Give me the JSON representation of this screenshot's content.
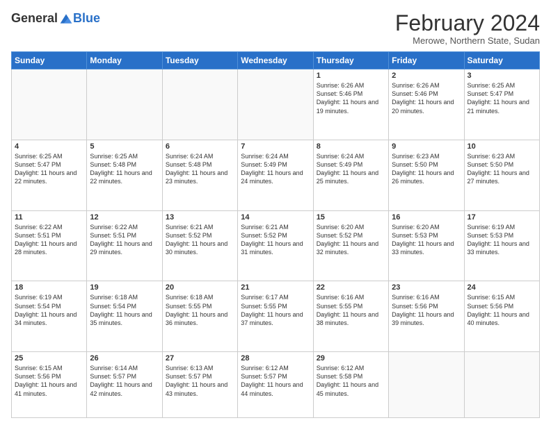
{
  "logo": {
    "general": "General",
    "blue": "Blue"
  },
  "header": {
    "month": "February 2024",
    "location": "Merowe, Northern State, Sudan"
  },
  "days_of_week": [
    "Sunday",
    "Monday",
    "Tuesday",
    "Wednesday",
    "Thursday",
    "Friday",
    "Saturday"
  ],
  "weeks": [
    [
      {
        "day": "",
        "info": ""
      },
      {
        "day": "",
        "info": ""
      },
      {
        "day": "",
        "info": ""
      },
      {
        "day": "",
        "info": ""
      },
      {
        "day": "1",
        "info": "Sunrise: 6:26 AM\nSunset: 5:46 PM\nDaylight: 11 hours and 19 minutes."
      },
      {
        "day": "2",
        "info": "Sunrise: 6:26 AM\nSunset: 5:46 PM\nDaylight: 11 hours and 20 minutes."
      },
      {
        "day": "3",
        "info": "Sunrise: 6:25 AM\nSunset: 5:47 PM\nDaylight: 11 hours and 21 minutes."
      }
    ],
    [
      {
        "day": "4",
        "info": "Sunrise: 6:25 AM\nSunset: 5:47 PM\nDaylight: 11 hours and 22 minutes."
      },
      {
        "day": "5",
        "info": "Sunrise: 6:25 AM\nSunset: 5:48 PM\nDaylight: 11 hours and 22 minutes."
      },
      {
        "day": "6",
        "info": "Sunrise: 6:24 AM\nSunset: 5:48 PM\nDaylight: 11 hours and 23 minutes."
      },
      {
        "day": "7",
        "info": "Sunrise: 6:24 AM\nSunset: 5:49 PM\nDaylight: 11 hours and 24 minutes."
      },
      {
        "day": "8",
        "info": "Sunrise: 6:24 AM\nSunset: 5:49 PM\nDaylight: 11 hours and 25 minutes."
      },
      {
        "day": "9",
        "info": "Sunrise: 6:23 AM\nSunset: 5:50 PM\nDaylight: 11 hours and 26 minutes."
      },
      {
        "day": "10",
        "info": "Sunrise: 6:23 AM\nSunset: 5:50 PM\nDaylight: 11 hours and 27 minutes."
      }
    ],
    [
      {
        "day": "11",
        "info": "Sunrise: 6:22 AM\nSunset: 5:51 PM\nDaylight: 11 hours and 28 minutes."
      },
      {
        "day": "12",
        "info": "Sunrise: 6:22 AM\nSunset: 5:51 PM\nDaylight: 11 hours and 29 minutes."
      },
      {
        "day": "13",
        "info": "Sunrise: 6:21 AM\nSunset: 5:52 PM\nDaylight: 11 hours and 30 minutes."
      },
      {
        "day": "14",
        "info": "Sunrise: 6:21 AM\nSunset: 5:52 PM\nDaylight: 11 hours and 31 minutes."
      },
      {
        "day": "15",
        "info": "Sunrise: 6:20 AM\nSunset: 5:52 PM\nDaylight: 11 hours and 32 minutes."
      },
      {
        "day": "16",
        "info": "Sunrise: 6:20 AM\nSunset: 5:53 PM\nDaylight: 11 hours and 33 minutes."
      },
      {
        "day": "17",
        "info": "Sunrise: 6:19 AM\nSunset: 5:53 PM\nDaylight: 11 hours and 33 minutes."
      }
    ],
    [
      {
        "day": "18",
        "info": "Sunrise: 6:19 AM\nSunset: 5:54 PM\nDaylight: 11 hours and 34 minutes."
      },
      {
        "day": "19",
        "info": "Sunrise: 6:18 AM\nSunset: 5:54 PM\nDaylight: 11 hours and 35 minutes."
      },
      {
        "day": "20",
        "info": "Sunrise: 6:18 AM\nSunset: 5:55 PM\nDaylight: 11 hours and 36 minutes."
      },
      {
        "day": "21",
        "info": "Sunrise: 6:17 AM\nSunset: 5:55 PM\nDaylight: 11 hours and 37 minutes."
      },
      {
        "day": "22",
        "info": "Sunrise: 6:16 AM\nSunset: 5:55 PM\nDaylight: 11 hours and 38 minutes."
      },
      {
        "day": "23",
        "info": "Sunrise: 6:16 AM\nSunset: 5:56 PM\nDaylight: 11 hours and 39 minutes."
      },
      {
        "day": "24",
        "info": "Sunrise: 6:15 AM\nSunset: 5:56 PM\nDaylight: 11 hours and 40 minutes."
      }
    ],
    [
      {
        "day": "25",
        "info": "Sunrise: 6:15 AM\nSunset: 5:56 PM\nDaylight: 11 hours and 41 minutes."
      },
      {
        "day": "26",
        "info": "Sunrise: 6:14 AM\nSunset: 5:57 PM\nDaylight: 11 hours and 42 minutes."
      },
      {
        "day": "27",
        "info": "Sunrise: 6:13 AM\nSunset: 5:57 PM\nDaylight: 11 hours and 43 minutes."
      },
      {
        "day": "28",
        "info": "Sunrise: 6:12 AM\nSunset: 5:57 PM\nDaylight: 11 hours and 44 minutes."
      },
      {
        "day": "29",
        "info": "Sunrise: 6:12 AM\nSunset: 5:58 PM\nDaylight: 11 hours and 45 minutes."
      },
      {
        "day": "",
        "info": ""
      },
      {
        "day": "",
        "info": ""
      }
    ]
  ]
}
